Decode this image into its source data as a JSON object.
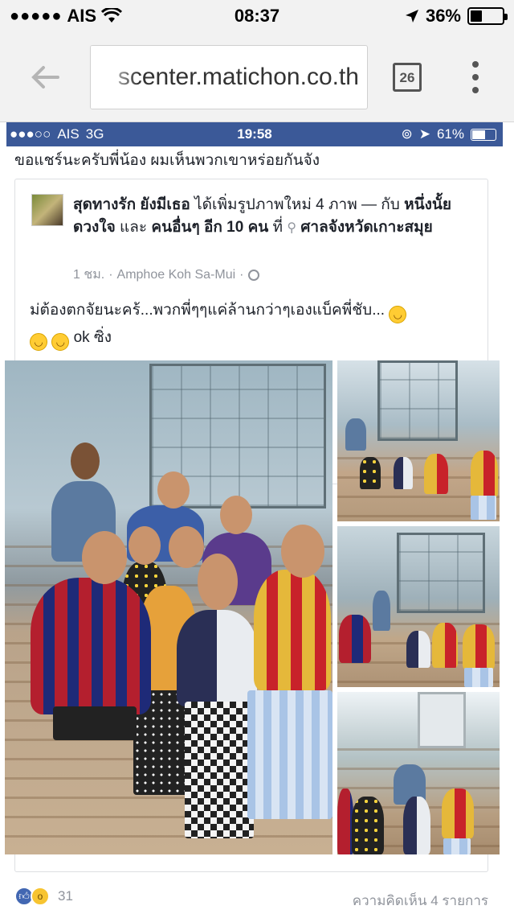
{
  "status_bar": {
    "carrier": "AIS",
    "time": "08:37",
    "battery": "36%",
    "battery_level": 0.36
  },
  "browser": {
    "url": "scenter.matichon.co.th",
    "tab_count": "26"
  },
  "screenshot_status": {
    "carrier": "AIS",
    "network": "3G",
    "time": "19:58",
    "battery": "61%",
    "battery_level": 0.61
  },
  "share_caption": "ขอแชร์นะครับพี่น้อง ผมเห็นพวกเขาหร่อยกันจัง",
  "post": {
    "author": "สุดทางรัก ยังมีเธอ",
    "action": "ได้เพิ่มรูปภาพใหม่ 4 ภาพ — กับ",
    "tag_1": "หนึ่งนั้ย ดวงใจ",
    "tag_and": "และ",
    "tag_others": "คนอื่นๆ อีก 10 คน",
    "at": "ที่",
    "place": "ศาลจังหวัดเกาะสมุย",
    "time": "1 ชม.",
    "location": "Amphoe Koh Sa-Mui",
    "text_line1": "ม่ต้องตกจัยนะคร้...พวกพี่ๆๆแค่ล้านกว่าๆเองแบ็คพี่ชับ...",
    "text_line2": "ok ซิ่ง"
  },
  "reactions": {
    "count": "31",
    "comments": "ความคิดเห็น 4 รายการ"
  }
}
